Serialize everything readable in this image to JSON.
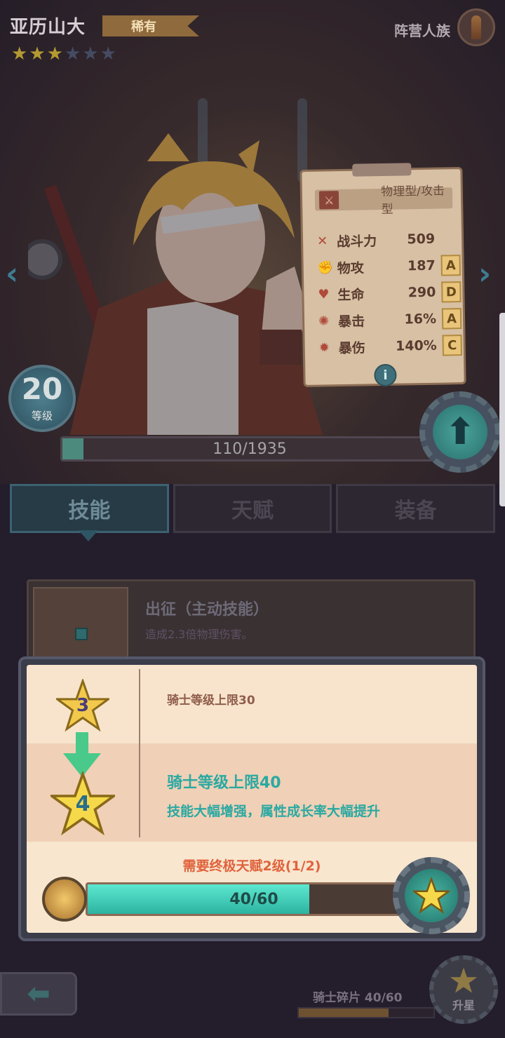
{
  "hero": {
    "name": "亚历山大",
    "rarity": "稀有",
    "stars_filled": 3,
    "stars_total": 6,
    "faction": "阵营人族",
    "faction_icon": "bullet-icon"
  },
  "stats": {
    "type": "物理型/攻击型",
    "rows": [
      {
        "icon": "power-icon",
        "label": "战斗力",
        "value": "509",
        "grade": ""
      },
      {
        "icon": "fist-icon",
        "label": "物攻",
        "value": "187",
        "grade": "A"
      },
      {
        "icon": "heart-icon",
        "label": "生命",
        "value": "290",
        "grade": "D"
      },
      {
        "icon": "crit-icon",
        "label": "暴击",
        "value": "16%",
        "grade": "A"
      },
      {
        "icon": "crit-damage-icon",
        "label": "暴伤",
        "value": "140%",
        "grade": "C"
      }
    ],
    "info_label": "i"
  },
  "level": {
    "value": "20",
    "label": "等级",
    "exp_text": "110/1935",
    "exp_fraction": 0.057
  },
  "tabs": [
    {
      "label": "技能",
      "active": true
    },
    {
      "label": "天赋",
      "active": false
    },
    {
      "label": "装备",
      "active": false
    }
  ],
  "skill": {
    "name": "出征（主动技能）",
    "desc": "造成2.3倍物理伤害。"
  },
  "starup": {
    "current_star": "3",
    "current_text": "骑士等级上限30",
    "next_star": "4",
    "next_title": "骑士等级上限40",
    "next_desc": "技能大幅增强，属性成长率大幅提升",
    "requirement": "需要终极天赋2级(1/2)",
    "progress_text": "40/60",
    "progress_fraction": 0.667
  },
  "bottom": {
    "fragments_label": "骑士碎片 40/60",
    "fragments_fraction": 0.667,
    "starup_label": "升星"
  },
  "colors": {
    "accent_teal": "#2aa9a2",
    "requirement_orange": "#e0623c",
    "star_gold": "#f2c94c"
  }
}
